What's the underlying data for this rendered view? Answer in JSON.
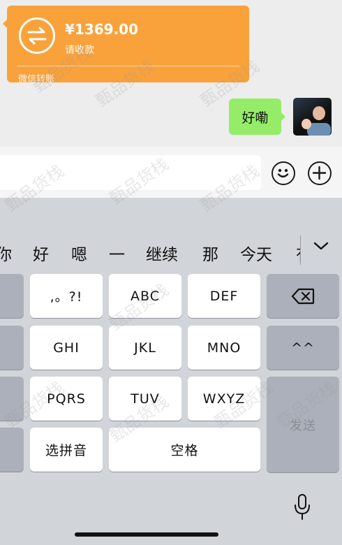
{
  "chat": {
    "transfer": {
      "amount": "¥1369.00",
      "status": "请收款",
      "type": "微信转账"
    },
    "my_message": "好嘞"
  },
  "inputbar": {
    "text_value": ""
  },
  "candidates": [
    "你",
    "好",
    "嗯",
    "一",
    "继续",
    "那",
    "今天",
    "有"
  ],
  "keys": {
    "punct": ",。?!",
    "abc": "ABC",
    "def": "DEF",
    "ghi": "GHI",
    "jkl": "JKL",
    "mno": "MNO",
    "caret": "^^",
    "pqrs": "PQRS",
    "tuv": "TUV",
    "wxyz": "WXYZ",
    "send": "发送",
    "pinyin": "选拼音",
    "space": "空格"
  },
  "watermark": "甄品货栈",
  "colors": {
    "transfer_bg": "#f9a23c",
    "bubble_bg": "#95ec69",
    "keyboard_bg": "#d1d4d9",
    "chat_bg": "#ededed"
  },
  "icons": [
    "transfer-arrows-icon",
    "emoji-icon",
    "plus-icon",
    "chevron-down-icon",
    "backspace-icon",
    "microphone-icon"
  ]
}
